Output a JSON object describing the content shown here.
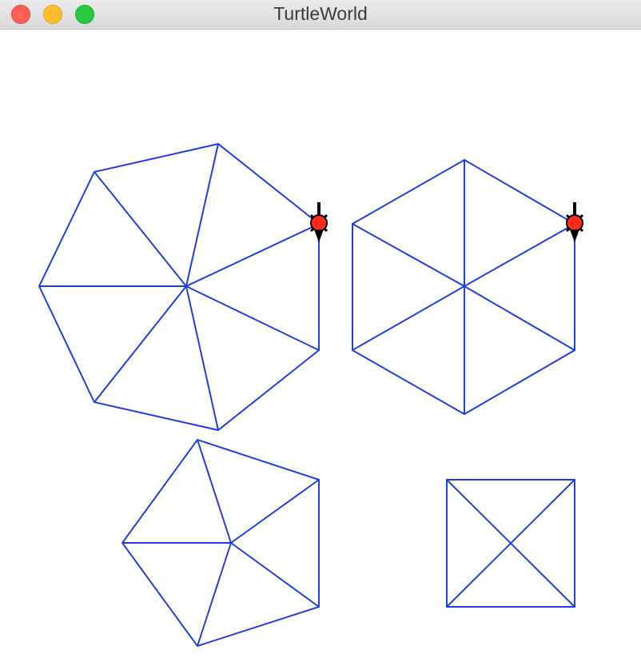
{
  "window": {
    "title": "TurtleWorld",
    "controls": {
      "close": "close-button",
      "minimize": "minimize-button",
      "zoom": "zoom-button"
    }
  },
  "canvas": {
    "stroke_color": "#1f3fe6",
    "turtle_body_color": "#ff2a1a",
    "turtle_outline_color": "#000000",
    "shapes": [
      {
        "name": "heptagon",
        "sides": 7
      },
      {
        "name": "hexagon",
        "sides": 6
      },
      {
        "name": "pentagon",
        "sides": 5
      },
      {
        "name": "square",
        "sides": 4
      }
    ],
    "turtles": 2
  }
}
